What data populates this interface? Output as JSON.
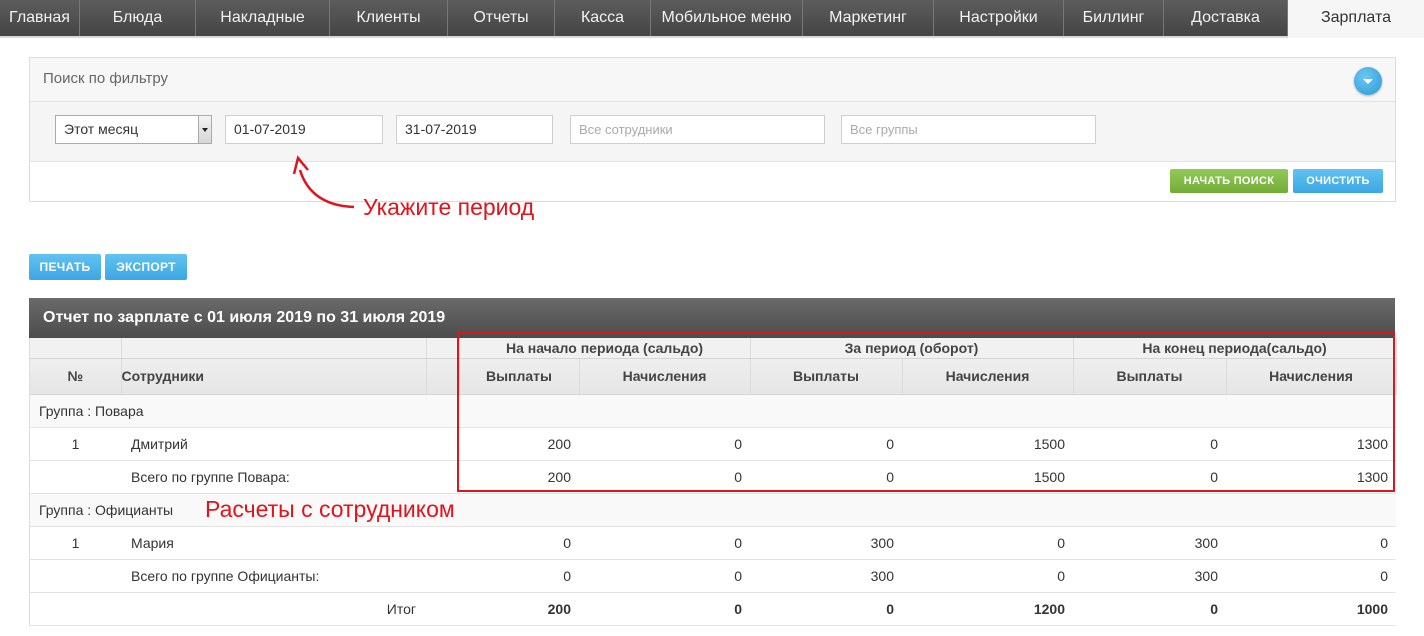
{
  "nav": {
    "items": [
      "Главная",
      "Блюда",
      "Накладные",
      "Клиенты",
      "Отчеты",
      "Касса",
      "Мобильное меню",
      "Маркетинг",
      "Настройки",
      "Биллинг",
      "Доставка",
      "Зарплата"
    ],
    "active": "Зарплата"
  },
  "filter": {
    "title": "Поиск по фильтру",
    "period_select": "Этот месяц",
    "date_from": "01-07-2019",
    "date_to": "31-07-2019",
    "employees_placeholder": "Все сотрудники",
    "groups_placeholder": "Все группы",
    "search_label": "НАЧАТЬ ПОИСК",
    "clear_label": "ОЧИСТИТЬ"
  },
  "annotations": {
    "period_hint": "Укажите период",
    "settlements_hint": "Расчеты с сотрудником"
  },
  "actions": {
    "print_label": "ПЕЧАТЬ",
    "export_label": "ЭКСПОРТ"
  },
  "colors": {
    "annotation": "#e2131b",
    "green_button": "#7fb944",
    "blue_button": "#4cb3ea",
    "header_bar": "#5a5a5a"
  },
  "report": {
    "title": "Отчет по зарплате с 01 июля 2019 по 31 июля 2019",
    "group_headers": [
      "На начало периода (сальдо)",
      "За период (оборот)",
      "На конец периода(сальдо)"
    ],
    "col_no": "№",
    "col_employees": "Сотрудники",
    "sub_headers": [
      "Выплаты",
      "Начисления",
      "Выплаты",
      "Начисления",
      "Выплаты",
      "Начисления"
    ],
    "group1": {
      "label": "Группа : Повара",
      "row": {
        "no": "1",
        "name": "Дмитрий",
        "values": [
          "200",
          "0",
          "0",
          "1500",
          "0",
          "1300"
        ]
      },
      "total": {
        "name": "Всего по группе Повара:",
        "values": [
          "200",
          "0",
          "0",
          "1500",
          "0",
          "1300"
        ]
      }
    },
    "group2": {
      "label": "Группа : Официанты",
      "row": {
        "no": "1",
        "name": "Мария",
        "values": [
          "0",
          "0",
          "300",
          "0",
          "300",
          "0"
        ]
      },
      "total": {
        "name": "Всего по группе Официанты:",
        "values": [
          "0",
          "0",
          "300",
          "0",
          "300",
          "0"
        ]
      }
    },
    "grand_total": {
      "label": "Итог",
      "values": [
        "200",
        "0",
        "0",
        "1200",
        "0",
        "1000"
      ]
    }
  }
}
